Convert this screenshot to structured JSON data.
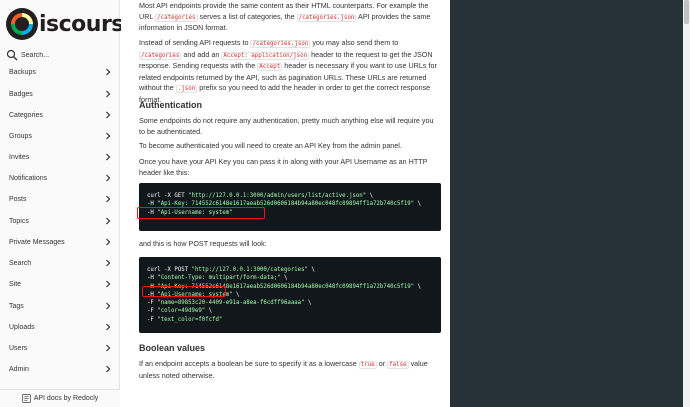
{
  "sidebar": {
    "logo_text": "iscourse",
    "search_placeholder": "Search...",
    "items": [
      {
        "label": "Backups"
      },
      {
        "label": "Badges"
      },
      {
        "label": "Categories"
      },
      {
        "label": "Groups"
      },
      {
        "label": "Invites"
      },
      {
        "label": "Notifications"
      },
      {
        "label": "Posts"
      },
      {
        "label": "Topics"
      },
      {
        "label": "Private Messages"
      },
      {
        "label": "Search"
      },
      {
        "label": "Site"
      },
      {
        "label": "Tags"
      },
      {
        "label": "Uploads"
      },
      {
        "label": "Users"
      },
      {
        "label": "Admin"
      }
    ],
    "footer_label": "API docs by Redocly"
  },
  "content": {
    "p1_a": "Most API endpoints provide the same content as their HTML counterparts. For example the URL ",
    "p1_code1": "/categories",
    "p1_b": " serves a list of categories, the ",
    "p1_code2": "/categories.json",
    "p1_c": " API provides the same information in JSON format.",
    "p2_a": "Instead of sending API requests to ",
    "p2_code1": "/categories.json",
    "p2_b": " you may also send them to ",
    "p2_code2": "/categories",
    "p2_c": " and add an ",
    "p2_code3": "Accept: application/json",
    "p2_d": " header to the request to get the JSON response. Sending requests with the ",
    "p2_code4": "Accept",
    "p2_e": " header is necessary if you want to use URLs for related endpoints returned by the API, such as pagination URLs. These URLs are returned without the ",
    "p2_code5": ".json",
    "p2_f": " prefix so you need to add the header in order to get the correct response format.",
    "h_auth": "Authentication",
    "p3": "Some endpoints do not require any authentication, pretty much anything else will require you to be authenticated.",
    "p4": "To become authenticated you will need to create an API Key from the admin panel.",
    "p5": "Once you have your API Key you can pass it in along with your API Username as an HTTP header like this:",
    "code1": [
      {
        "plain": "curl -X GET ",
        "str": "\"http://127.0.0.1:3000/admin/users/list/active.json\"",
        "end": " \\"
      },
      {
        "plain": "-H ",
        "str": "\"Api-Key: 714552c6148e1617aeab526d0606184b94a80ec048fc09894ff1a72b740c5f19\"",
        "end": " \\"
      },
      {
        "plain": "-H ",
        "str": "\"Api-Username: system\"",
        "end": ""
      }
    ],
    "p6": "and this is how POST requests will look:",
    "code2": [
      {
        "plain": "curl -X POST ",
        "str": "\"http://127.0.0.1:3000/categories\"",
        "end": " \\"
      },
      {
        "plain": "-H ",
        "str": "\"Content-Type: multipart/form-data;\"",
        "end": " \\"
      },
      {
        "plain": "-H ",
        "str": "\"Api-Key: 714552c6148e1617aeab526d0606184b94a80ec048fc09894ff1a72b740c5f19\"",
        "end": " \\"
      },
      {
        "plain": "-H ",
        "str": "\"Api-Username: system\"",
        "end": " \\"
      },
      {
        "plain": "-F ",
        "str": "\"name=89853c20-4409-e91a-a8ea-f6cdff96aaaa\"",
        "end": " \\"
      },
      {
        "plain": "-F ",
        "str": "\"color=49d9e9\"",
        "end": " \\"
      },
      {
        "plain": "-F ",
        "str": "\"text_color=f0fcfd\"",
        "end": ""
      }
    ],
    "h_bool": "Boolean values",
    "p7_a": "If an endpoint accepts a boolean be sure to specify it as a lowercase ",
    "p7_code1": "true",
    "p7_b": " or ",
    "p7_code2": "false",
    "p7_c": " value unless noted otherwise."
  },
  "colors": {
    "right_panel": "#263238",
    "code_bg": "#11171a",
    "code_string": "#a0fbaa",
    "inline_code": "#d02f2f",
    "highlight": "#e8141a"
  }
}
